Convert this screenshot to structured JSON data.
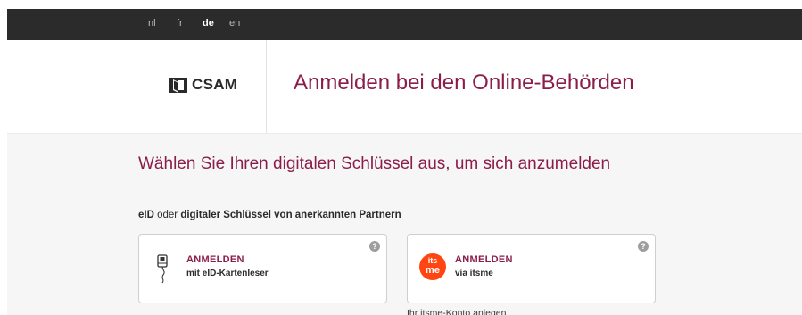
{
  "languages": [
    {
      "code": "nl",
      "active": false
    },
    {
      "code": "fr",
      "active": false
    },
    {
      "code": "de",
      "active": true
    },
    {
      "code": "en",
      "active": false
    }
  ],
  "header": {
    "logo_text": "CSAM",
    "title": "Anmelden bei den Online-Behörden"
  },
  "main": {
    "subtitle": "Wählen Sie Ihren digitalen Schlüssel aus, um sich anzumelden",
    "intro": {
      "part1": "eID",
      "connector": " oder ",
      "part2": "digitaler Schlüssel von anerkannten Partnern"
    },
    "cards": [
      {
        "title": "ANMELDEN",
        "description": "mit eID-Kartenleser",
        "icon": "card-reader-icon",
        "help": "?"
      },
      {
        "title": "ANMELDEN",
        "description": "via itsme",
        "icon": "itsme-icon",
        "icon_text_1": "its",
        "icon_text_2": "me",
        "help": "?"
      }
    ],
    "create_account_link": "Ihr itsme-Konto anlegen"
  },
  "colors": {
    "accent": "#8b1d4a",
    "topbar": "#2b2b2b",
    "itsme": "#ff4612",
    "background": "#f6f6f6"
  }
}
